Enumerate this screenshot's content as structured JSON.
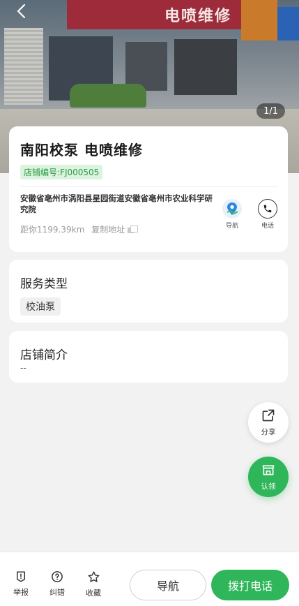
{
  "hero": {
    "sign_text": "电喷维修",
    "image_counter": "1/1"
  },
  "shop": {
    "name": "南阳校泵 电喷维修",
    "code": "店铺编号:FJ000505",
    "address": "安徽省亳州市涡阳县星园街道安徽省亳州市农业科学研究院",
    "distance": "距你1199.39km",
    "copy_address": "复制地址",
    "nav_label": "导航",
    "call_label": "电话"
  },
  "service": {
    "title": "服务类型",
    "tags": [
      "校油泵"
    ]
  },
  "intro": {
    "title": "店铺简介",
    "text": "--"
  },
  "floating": {
    "share_label": "分享",
    "claim_label": "认领"
  },
  "bottom_bar": {
    "report_label": "举报",
    "correct_label": "纠错",
    "favorite_label": "收藏",
    "navigate_button": "导航",
    "call_button": "拨打电话"
  },
  "colors": {
    "accent_green": "#2fb65a",
    "code_bg": "#dbf3df",
    "code_text": "#2f9b47"
  }
}
